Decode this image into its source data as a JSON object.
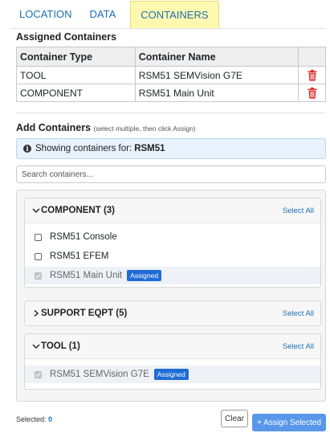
{
  "tabs": [
    {
      "label": "LOCATION"
    },
    {
      "label": "DATA"
    },
    {
      "label": "CONTAINERS"
    }
  ],
  "active_tab": "CONTAINERS",
  "assigned": {
    "title": "Assigned Containers",
    "headers": {
      "type": "Container Type",
      "name": "Container Name"
    },
    "rows": [
      {
        "type": "TOOL",
        "name": "RSM51 SEMVision G7E"
      },
      {
        "type": "COMPONENT",
        "name": "RSM51 Main Unit"
      }
    ]
  },
  "add": {
    "title": "Add Containers",
    "hint": "(select multiple, then click Assign)",
    "info_prefix": "Showing containers for:",
    "info_target": "RSM51",
    "search_placeholder": "Search containers...",
    "select_all_label": "Select All",
    "assigned_badge": "Assigned",
    "groups": [
      {
        "label": "COMPONENT (3)",
        "expanded": true,
        "items": [
          {
            "label": "RSM51 Console",
            "checked": false,
            "assigned": false
          },
          {
            "label": "RSM51 EFEM",
            "checked": false,
            "assigned": false
          },
          {
            "label": "RSM51 Main Unit",
            "checked": true,
            "assigned": true
          }
        ]
      },
      {
        "label": "SUPPORT EQPT (5)",
        "expanded": false,
        "items": []
      },
      {
        "label": "TOOL (1)",
        "expanded": true,
        "items": [
          {
            "label": "RSM51 SEMVision G7E",
            "checked": true,
            "assigned": true
          }
        ]
      }
    ]
  },
  "footer": {
    "selected_label": "Selected:",
    "selected_count": "0",
    "clear_label": "Clear",
    "assign_label": "+ Assign Selected"
  },
  "colors": {
    "accent": "#1f6fb5",
    "active_tab_bg": "#fff9b0",
    "trash": "#d9302a",
    "badge": "#1e6cd6",
    "assign_button": "#3b86e6"
  },
  "icons": {
    "delete": "trash-icon",
    "info": "info-icon",
    "expanded": "chevron-down-icon",
    "collapsed": "chevron-right-icon"
  }
}
